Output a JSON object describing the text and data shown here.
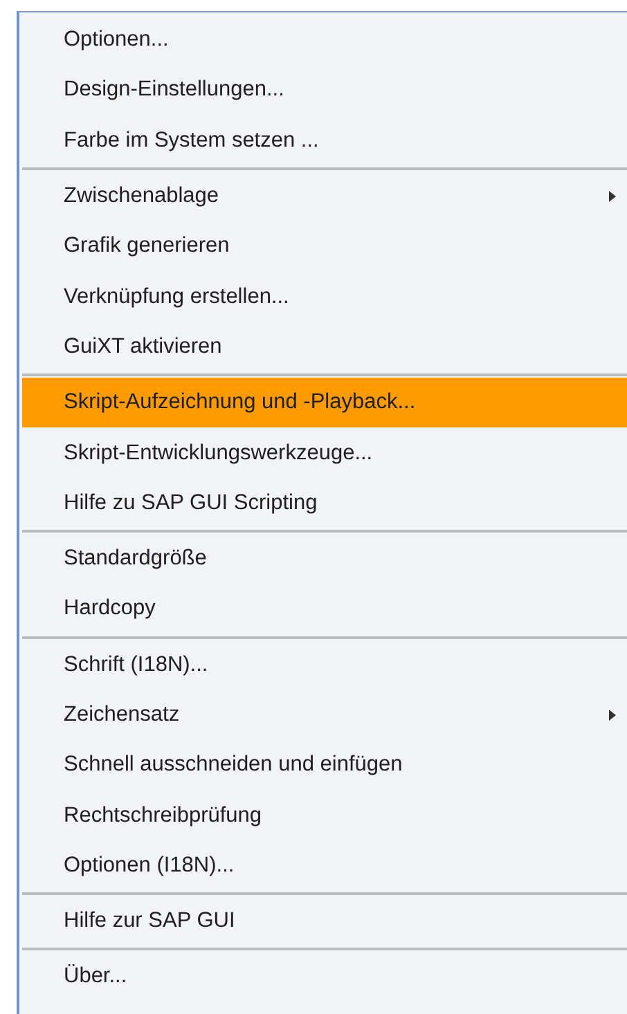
{
  "menu": {
    "groups": [
      {
        "items": [
          {
            "label": "Optionen...",
            "submenu": false,
            "selected": false
          },
          {
            "label": "Design-Einstellungen...",
            "submenu": false,
            "selected": false
          },
          {
            "label": "Farbe im System setzen ...",
            "submenu": false,
            "selected": false
          }
        ]
      },
      {
        "items": [
          {
            "label": "Zwischenablage",
            "submenu": true,
            "selected": false
          },
          {
            "label": "Grafik generieren",
            "submenu": false,
            "selected": false
          },
          {
            "label": "Verknüpfung erstellen...",
            "submenu": false,
            "selected": false
          },
          {
            "label": "GuiXT aktivieren",
            "submenu": false,
            "selected": false
          }
        ]
      },
      {
        "items": [
          {
            "label": "Skript-Aufzeichnung und -Playback...",
            "submenu": false,
            "selected": true
          },
          {
            "label": "Skript-Entwicklungswerkzeuge...",
            "submenu": false,
            "selected": false
          },
          {
            "label": "Hilfe zu SAP GUI Scripting",
            "submenu": false,
            "selected": false
          }
        ]
      },
      {
        "items": [
          {
            "label": "Standardgröße",
            "submenu": false,
            "selected": false
          },
          {
            "label": "Hardcopy",
            "submenu": false,
            "selected": false
          }
        ]
      },
      {
        "items": [
          {
            "label": "Schrift (I18N)...",
            "submenu": false,
            "selected": false
          },
          {
            "label": "Zeichensatz",
            "submenu": true,
            "selected": false
          },
          {
            "label": "Schnell ausschneiden und einfügen",
            "submenu": false,
            "selected": false
          },
          {
            "label": "Rechtschreibprüfung",
            "submenu": false,
            "selected": false
          },
          {
            "label": "Optionen (I18N)...",
            "submenu": false,
            "selected": false
          }
        ]
      },
      {
        "items": [
          {
            "label": "Hilfe zur SAP GUI",
            "submenu": false,
            "selected": false
          }
        ]
      },
      {
        "items": [
          {
            "label": "Über...",
            "submenu": false,
            "selected": false
          }
        ]
      }
    ]
  }
}
